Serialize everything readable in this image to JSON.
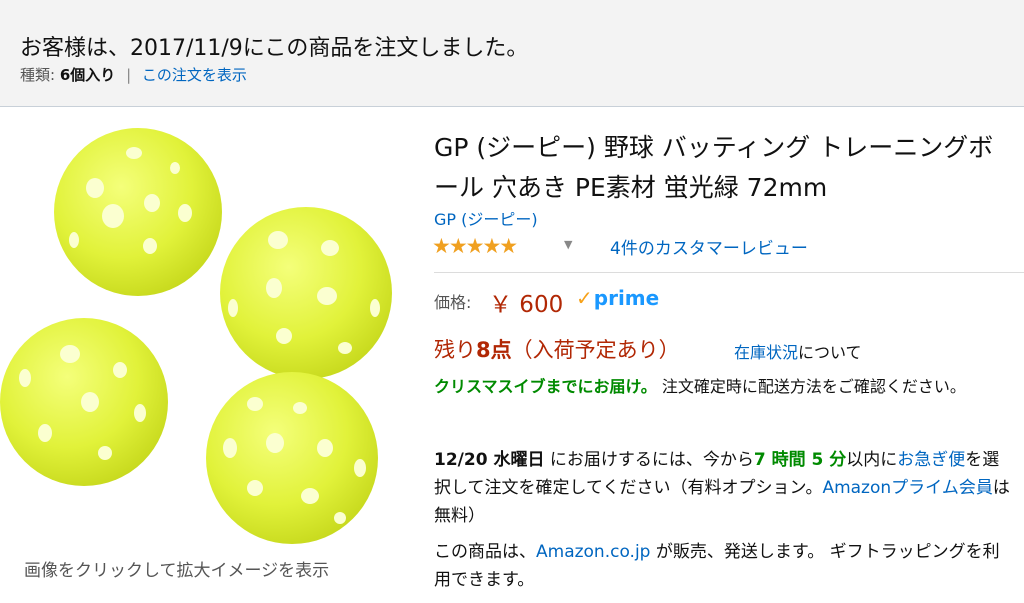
{
  "banner": {
    "title": "お客様は、2017/11/9にこの商品を注文しました。",
    "kind_label": "種類:",
    "kind_value": "6個入り",
    "separator": "|",
    "view_order_link": "この注文を表示"
  },
  "image": {
    "caption": "画像をクリックして拡大イメージを表示",
    "ball_color": "#e4f43c"
  },
  "product": {
    "title": "GP (ジーピー) 野球 バッティング トレーニングボール 穴あき PE素材 蛍光緑 72mm",
    "brand": "GP (ジーピー)",
    "stars": "★★★★★",
    "rating_stars": 5,
    "review_link": "4件のカスタマーレビュー",
    "price_label": "価格:",
    "price": "￥ 600",
    "prime_label": "prime",
    "prime_check": "✓",
    "stock_prefix": "残り",
    "stock_count": "8点",
    "stock_suffix": "（入荷予定あり）",
    "stock_link": "在庫状況",
    "stock_link_suffix": "について",
    "xmas_highlight": "クリスマスイブまでにお届け。",
    "xmas_text": " 注文確定時に配送方法をご確認ください。",
    "delivery_date": "12/20 水曜日",
    "delivery_text1": " にお届けするには、今から",
    "delivery_hours": "7 時間 5 分",
    "delivery_text2": "以内に",
    "delivery_rush_link": "お急ぎ便",
    "delivery_text3": "を選択して注文を確定してください（有料オプション。",
    "delivery_prime_link": "Amazonプライム会員",
    "delivery_text4": "は無料）",
    "seller_text1": "この商品は、",
    "seller_link": "Amazon.co.jp",
    "seller_text2": " が販売、発送します。 ギフトラッピングを利用できます。"
  },
  "colors": {
    "accent_link": "#0066c0",
    "price_red": "#b12704",
    "green": "#008a00",
    "star": "#f0a020",
    "prime_blue": "#1a98ff"
  }
}
